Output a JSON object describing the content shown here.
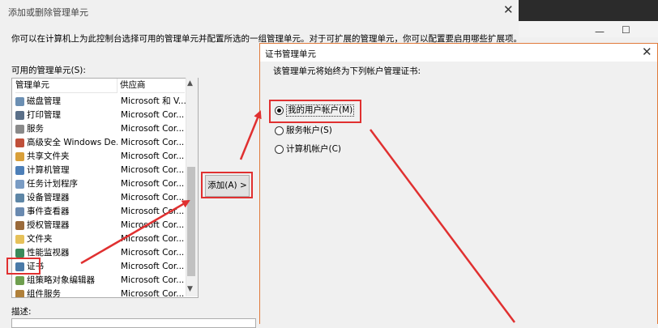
{
  "bg_dialog": {
    "title": "添加或删除管理单元",
    "description": "你可以在计算机上为此控制台选择可用的管理单元并配置所选的一组管理单元。对于可扩展的管理单元，你可以配置要启用哪些扩展项。",
    "available_label": "可用的管理单元(S):",
    "columns": {
      "name": "管理单元",
      "vendor": "供应商"
    },
    "rows": [
      {
        "name": "磁盘管理",
        "vendor": "Microsoft 和 V...",
        "icon": "disk-icon"
      },
      {
        "name": "打印管理",
        "vendor": "Microsoft Cor...",
        "icon": "printer-icon"
      },
      {
        "name": "服务",
        "vendor": "Microsoft Cor...",
        "icon": "gear-icon"
      },
      {
        "name": "高级安全 Windows De...",
        "vendor": "Microsoft Cor...",
        "icon": "firewall-icon"
      },
      {
        "name": "共享文件夹",
        "vendor": "Microsoft Cor...",
        "icon": "shared-folder-icon"
      },
      {
        "name": "计算机管理",
        "vendor": "Microsoft Cor...",
        "icon": "computer-icon"
      },
      {
        "name": "任务计划程序",
        "vendor": "Microsoft Cor...",
        "icon": "clock-icon"
      },
      {
        "name": "设备管理器",
        "vendor": "Microsoft Cor...",
        "icon": "device-icon"
      },
      {
        "name": "事件查看器",
        "vendor": "Microsoft Cor...",
        "icon": "event-icon"
      },
      {
        "name": "授权管理器",
        "vendor": "Microsoft Cor...",
        "icon": "auth-icon"
      },
      {
        "name": "文件夹",
        "vendor": "Microsoft Cor...",
        "icon": "folder-icon"
      },
      {
        "name": "性能监视器",
        "vendor": "Microsoft Cor...",
        "icon": "performance-icon"
      },
      {
        "name": "证书",
        "vendor": "Microsoft Cor...",
        "icon": "certificate-icon"
      },
      {
        "name": "组策略对象编辑器",
        "vendor": "Microsoft Cor...",
        "icon": "policy-icon"
      },
      {
        "name": "组件服务",
        "vendor": "Microsoft Cor...",
        "icon": "component-icon"
      }
    ],
    "description_label": "描述:",
    "add_button": "添加(A) >"
  },
  "cert_dialog": {
    "title": "证书管理单元",
    "prompt": "该管理单元将始终为下列帐户管理证书:",
    "options": [
      {
        "label": "我的用户帐户(M)",
        "selected": true
      },
      {
        "label": "服务帐户(S)",
        "selected": false
      },
      {
        "label": "计算机帐户(C)",
        "selected": false
      }
    ]
  },
  "window_controls": {
    "close": "✕",
    "minimize": "—",
    "maximize": "☐",
    "scroll_up": "▲",
    "scroll_down": "▼"
  },
  "colors": {
    "highlight": "#e03030",
    "accent": "#e07a3a"
  }
}
